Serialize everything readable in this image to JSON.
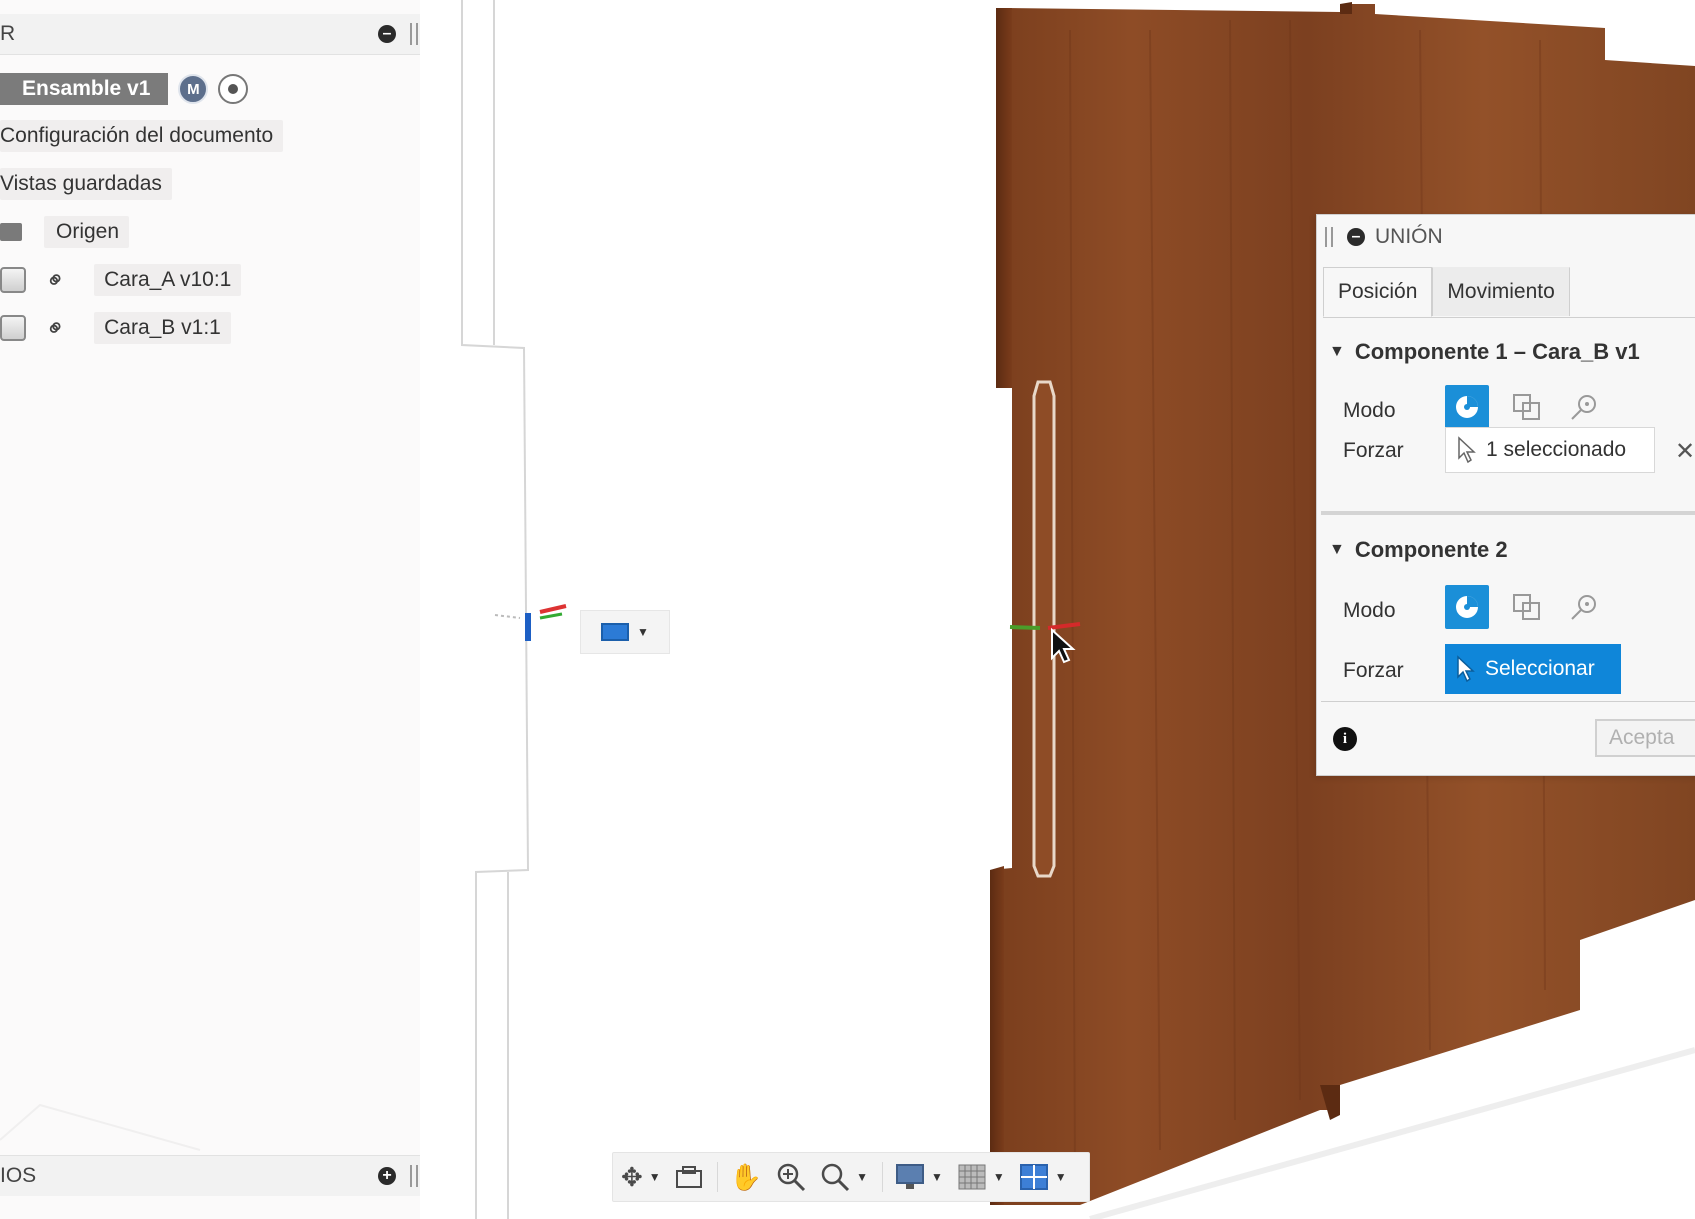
{
  "browser": {
    "header_title": "R",
    "root": {
      "label": "Ensamble v1",
      "badge": "M"
    },
    "items": [
      {
        "label": "Configuración del documento"
      },
      {
        "label": "Vistas guardadas"
      },
      {
        "label": "Origen",
        "icon": "folder-icon"
      },
      {
        "label": "Cara_A v10:1",
        "icon": "component-box-icon",
        "link": "link-icon"
      },
      {
        "label": "Cara_B v1:1",
        "icon": "component-box-icon",
        "link": "link-icon"
      }
    ],
    "footer_title": "IOS"
  },
  "joint_dialog": {
    "title": "UNIÓN",
    "tabs": [
      "Posición",
      "Movimiento"
    ],
    "active_tab": "Posición",
    "component1": {
      "heading": "Componente 1 – Cara_B v1",
      "mode_label": "Modo",
      "force_label": "Forzar",
      "force_value": "1 seleccionado"
    },
    "component2": {
      "heading": "Componente 2",
      "mode_label": "Modo",
      "force_label": "Forzar",
      "select_label": "Seleccionar"
    },
    "accept_label": "Acepta",
    "clear_symbol": "✕"
  },
  "toolbar": {
    "tools": [
      "orbit-icon",
      "look-at-icon",
      "pan-icon",
      "zoom-icon",
      "fit-icon",
      "display-settings-icon",
      "grid-icon",
      "viewports-icon"
    ]
  },
  "colors": {
    "accent": "#1b8fd8",
    "wood": "#8a4a24",
    "panel": "#f7f7f7"
  }
}
